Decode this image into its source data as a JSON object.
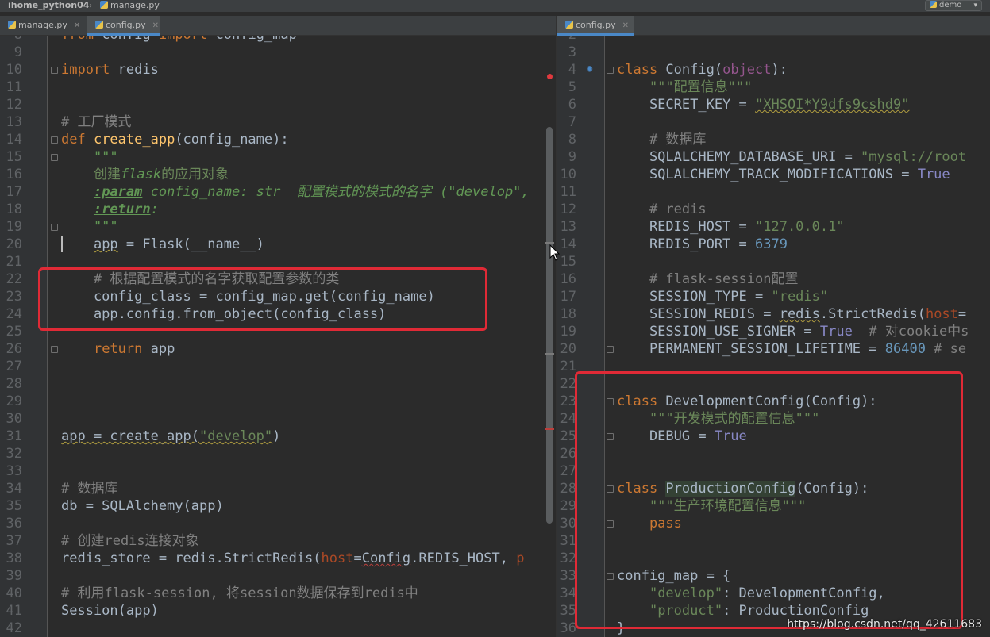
{
  "topbar": {
    "project": "ihome_python04",
    "file": "manage.py",
    "run_config": "demo"
  },
  "left_tabs": [
    {
      "label": "manage.py"
    },
    {
      "label": "config.py"
    }
  ],
  "right_tabs": [
    {
      "label": "config.py"
    }
  ],
  "left_editor": {
    "lines": [
      {
        "n": "8"
      },
      {
        "n": "9"
      },
      {
        "n": "10"
      },
      {
        "n": "11"
      },
      {
        "n": "12"
      },
      {
        "n": "13"
      },
      {
        "n": "14"
      },
      {
        "n": "15"
      },
      {
        "n": "16"
      },
      {
        "n": "17"
      },
      {
        "n": "18"
      },
      {
        "n": "19"
      },
      {
        "n": "20"
      },
      {
        "n": "21"
      },
      {
        "n": "22"
      },
      {
        "n": "23"
      },
      {
        "n": "24"
      },
      {
        "n": "25"
      },
      {
        "n": "26"
      },
      {
        "n": "27"
      },
      {
        "n": "28"
      },
      {
        "n": "29"
      },
      {
        "n": "30"
      },
      {
        "n": "31"
      },
      {
        "n": "32"
      },
      {
        "n": "33"
      },
      {
        "n": "34"
      },
      {
        "n": "35"
      },
      {
        "n": "36"
      },
      {
        "n": "37"
      },
      {
        "n": "38"
      },
      {
        "n": "39"
      },
      {
        "n": "40"
      },
      {
        "n": "41"
      },
      {
        "n": "42"
      }
    ],
    "code": {
      "l8_a": "from",
      "l8_b": " config ",
      "l8_c": "import",
      "l8_d": " config_map",
      "l10_a": "import",
      "l10_b": " redis",
      "l13": "# 工厂模式",
      "l14_a": "def ",
      "l14_b": "create_app",
      "l14_c": "(config_name):",
      "l15": "    \"\"\"",
      "l16_a": "    创建",
      "l16_b": "flask",
      "l16_c": "的应用对象",
      "l17_a": "    ",
      "l17_b": ":param",
      "l17_c": " config_name: str  配置模式的模式的名字 (\"develop\",",
      "l18_a": "    ",
      "l18_b": ":return",
      "l18_c": ":",
      "l19": "    \"\"\"",
      "l20_a": "    ",
      "l20_b": "app",
      "l20_c": " = Flask(__name__)",
      "l22": "    # 根据配置模式的名字获取配置参数的类",
      "l23": "    config_class = config_map.get(config_name)",
      "l24": "    app.config.from_object(config_class)",
      "l26_a": "    ",
      "l26_b": "return",
      "l26_c": " app",
      "l31_a": "app = create_app(",
      "l31_b": "\"develop\"",
      "l31_c": ")",
      "l34": "# 数据库",
      "l35": "db = SQLAlchemy(app)",
      "l37": "# 创建redis连接对象",
      "l38_a": "redis_store = redis.StrictRedis(",
      "l38_b": "host",
      "l38_c": "=",
      "l38_d": "Config",
      "l38_e": ".REDIS_HOST, ",
      "l38_f": "p",
      "l40": "# 利用flask-session, 将session数据保存到redis中",
      "l41": "Session(app)"
    }
  },
  "right_editor": {
    "lines": [
      {
        "n": "2"
      },
      {
        "n": "3"
      },
      {
        "n": "4"
      },
      {
        "n": "5"
      },
      {
        "n": "6"
      },
      {
        "n": "7"
      },
      {
        "n": "8"
      },
      {
        "n": "9"
      },
      {
        "n": "10"
      },
      {
        "n": "11"
      },
      {
        "n": "12"
      },
      {
        "n": "13"
      },
      {
        "n": "14"
      },
      {
        "n": "15"
      },
      {
        "n": "16"
      },
      {
        "n": "17"
      },
      {
        "n": "18"
      },
      {
        "n": "19"
      },
      {
        "n": "20"
      },
      {
        "n": "21"
      },
      {
        "n": "22"
      },
      {
        "n": "23"
      },
      {
        "n": "24"
      },
      {
        "n": "25"
      },
      {
        "n": "26"
      },
      {
        "n": "27"
      },
      {
        "n": "28"
      },
      {
        "n": "29"
      },
      {
        "n": "30"
      },
      {
        "n": "31"
      },
      {
        "n": "32"
      },
      {
        "n": "33"
      },
      {
        "n": "34"
      },
      {
        "n": "35"
      },
      {
        "n": "36"
      }
    ],
    "code": {
      "r4_a": "class ",
      "r4_b": "Config",
      "r4_c": "(",
      "r4_d": "object",
      "r4_e": "):",
      "r5": "    \"\"\"配置信息\"\"\"",
      "r6_a": "    SECRET_KEY = ",
      "r6_b": "\"XHSOI*Y9dfs9cshd9\"",
      "r8": "    # 数据库",
      "r9_a": "    SQLALCHEMY_DATABASE_URI = ",
      "r9_b": "\"mysql://root",
      "r10_a": "    SQLALCHEMY_TRACK_MODIFICATIONS = ",
      "r10_b": "True",
      "r12": "    # redis",
      "r13_a": "    REDIS_HOST = ",
      "r13_b": "\"127.0.0.1\"",
      "r14_a": "    REDIS_PORT = ",
      "r14_b": "6379",
      "r16": "    # flask-session配置",
      "r17_a": "    SESSION_TYPE = ",
      "r17_b": "\"redis\"",
      "r18_a": "    SESSION_REDIS = ",
      "r18_b": "redis",
      "r18_c": ".StrictRedis(",
      "r18_d": "host",
      "r18_e": "=",
      "r19_a": "    SESSION_USE_SIGNER = ",
      "r19_b": "True",
      "r19_c": "  # 对cookie中s",
      "r20_a": "    PERMANENT_SESSION_LIFETIME = ",
      "r20_b": "86400",
      "r20_c": " # se",
      "r23_a": "class ",
      "r23_b": "DevelopmentConfig",
      "r23_c": "(Config):",
      "r24": "    \"\"\"开发模式的配置信息\"\"\"",
      "r25_a": "    DEBUG = ",
      "r25_b": "True",
      "r28_a": "class ",
      "r28_b": "ProductionConfig",
      "r28_c": "(Config):",
      "r29": "    \"\"\"生产环境配置信息\"\"\"",
      "r30": "    pass",
      "r33": "config_map = {",
      "r34_a": "    ",
      "r34_b": "\"develop\"",
      "r34_c": ": DevelopmentConfig,",
      "r35_a": "    ",
      "r35_b": "\"product\"",
      "r35_c": ": ProductionConfig",
      "r36": "}"
    }
  },
  "watermark": "https://blog.csdn.net/qq_42611683",
  "colors": {
    "background": "#2b2b2b",
    "keyword": "#cc7832",
    "function": "#ffc66d",
    "string": "#6a8759",
    "comment": "#808080",
    "number": "#6897bb",
    "highlight_box": "#e02a36"
  }
}
